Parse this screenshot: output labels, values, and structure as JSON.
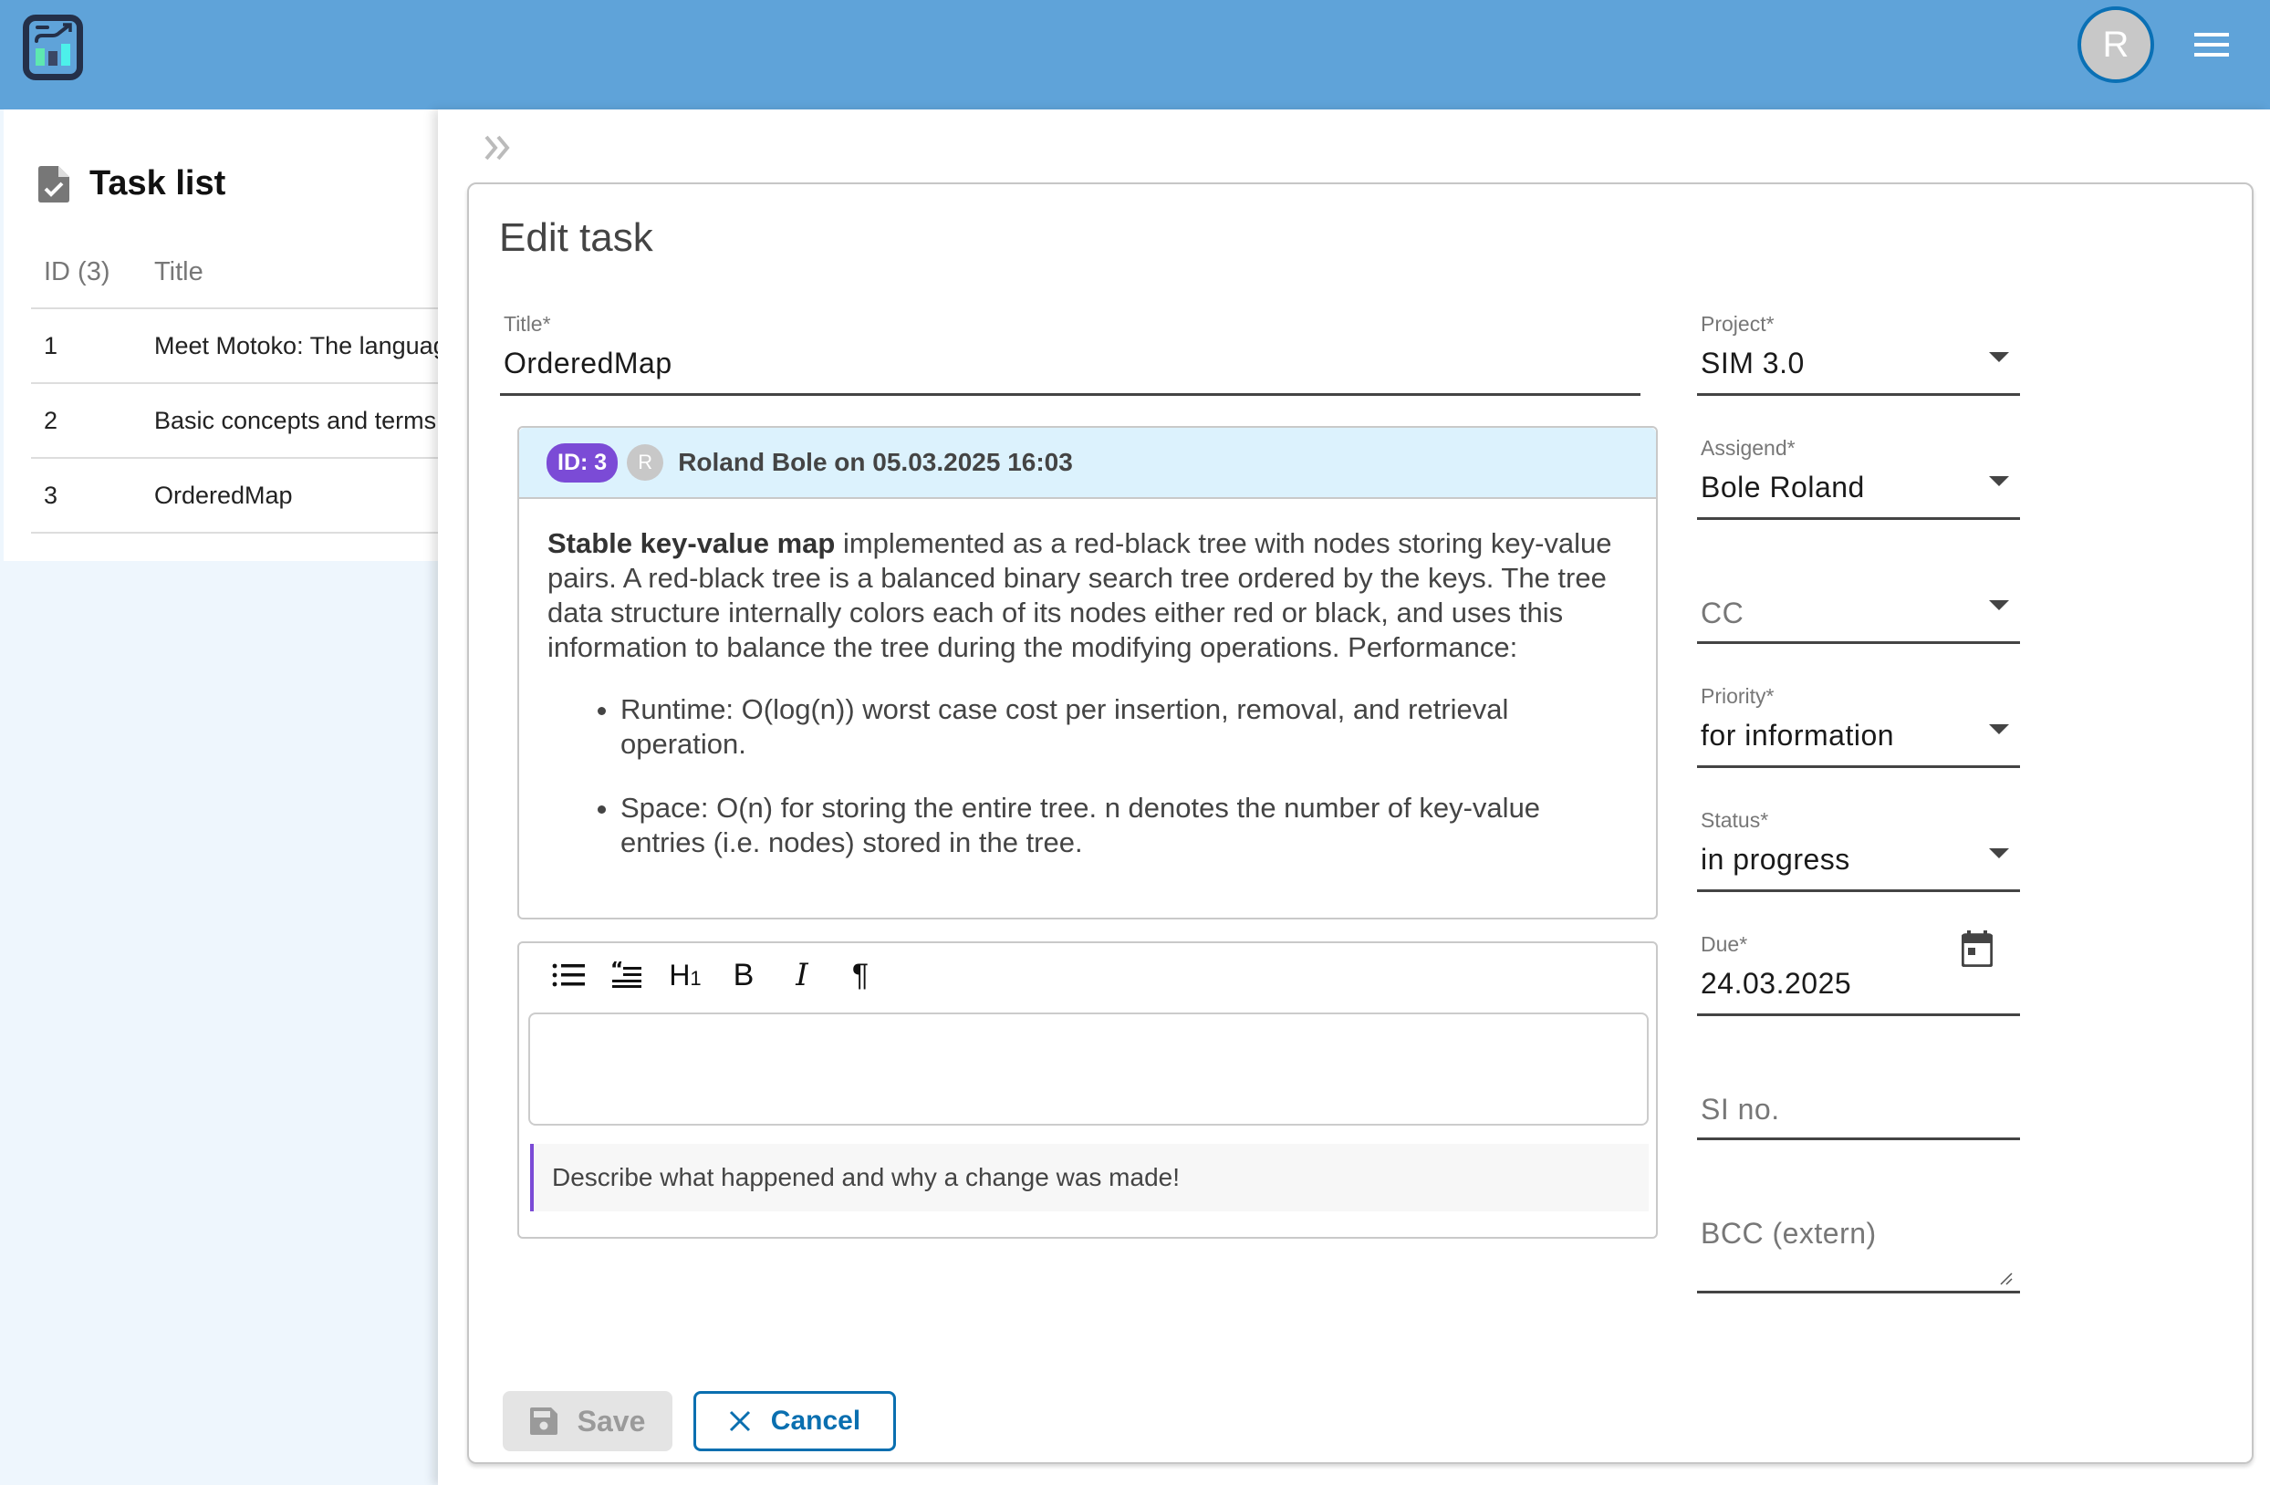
{
  "header": {
    "avatar_initial": "R",
    "logo_icon": "chart-logo-icon",
    "menu_icon": "hamburger-menu-icon"
  },
  "tasklist": {
    "title": "Task list",
    "icon": "task-document-check-icon",
    "columns": [
      "ID (3)",
      "Title"
    ],
    "rows": [
      {
        "id": "1",
        "title": "Meet Motoko: The language"
      },
      {
        "id": "2",
        "title": "Basic concepts and terms"
      },
      {
        "id": "3",
        "title": "OrderedMap"
      }
    ]
  },
  "panel": {
    "collapse_icon": "double-chevron-right-icon",
    "heading": "Edit task"
  },
  "form": {
    "title": {
      "label": "Title*",
      "value": "OrderedMap"
    },
    "project": {
      "label": "Project*",
      "value": "SIM 3.0"
    },
    "assigned": {
      "label": "Assigend*",
      "value": "Bole Roland"
    },
    "cc": {
      "placeholder": "CC"
    },
    "priority": {
      "label": "Priority*",
      "value": "for information"
    },
    "status": {
      "label": "Status*",
      "value": "in progress"
    },
    "due": {
      "label": "Due*",
      "value": "24.03.2025"
    },
    "si_no": {
      "placeholder": "SI no."
    },
    "bcc": {
      "placeholder": "BCC (extern)"
    }
  },
  "comment": {
    "id_badge": "ID: 3",
    "avatar_initial": "R",
    "meta": "Roland Bole on 05.03.2025 16:03",
    "body_bold": "Stable key-value map",
    "body_text": " implemented as a red-black tree with nodes storing key-value pairs. A red-black tree is a balanced binary search tree ordered by the keys. The tree data structure internally colors each of its nodes either red or black, and uses this information to balance the tree during the modifying operations. Performance:",
    "bullets": [
      "Runtime: O(log(n)) worst case cost per insertion, removal, and retrieval operation.",
      "Space: O(n) for storing the entire tree. n denotes the number of key-value entries (i.e. nodes) stored in the tree."
    ]
  },
  "editor": {
    "toolbar": {
      "bullet_list": "☰",
      "heading": "H1",
      "bold": "B",
      "italic": "I",
      "paragraph": "¶"
    },
    "hint": "Describe what happened and why a change was made!"
  },
  "buttons": {
    "save": "Save",
    "cancel": "Cancel"
  },
  "colors": {
    "topbar": "#5fa3d9",
    "accent_purple": "#7b4bd6",
    "accent_blue": "#0a6fb0",
    "comment_header": "#dcf2fd"
  }
}
